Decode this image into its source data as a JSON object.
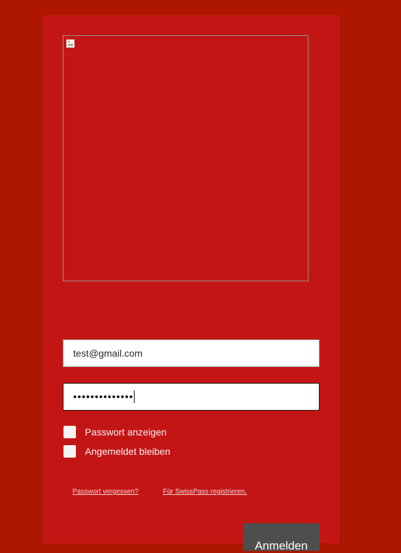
{
  "login": {
    "email_value": "test@gmail.com",
    "password_masked": "••••••••••••••",
    "show_password_label": "Passwort anzeigen",
    "stay_logged_in_label": "Angemeldet bleiben",
    "forgot_password_link": "Passwort vergessen?",
    "register_link": "Für SwissPass registrieren.",
    "submit_label": "Anmelden"
  },
  "colors": {
    "background": "#ad1600",
    "panel": "#c41515",
    "button": "#4e4e4e"
  },
  "icons": {
    "logo": "broken-image-icon"
  }
}
